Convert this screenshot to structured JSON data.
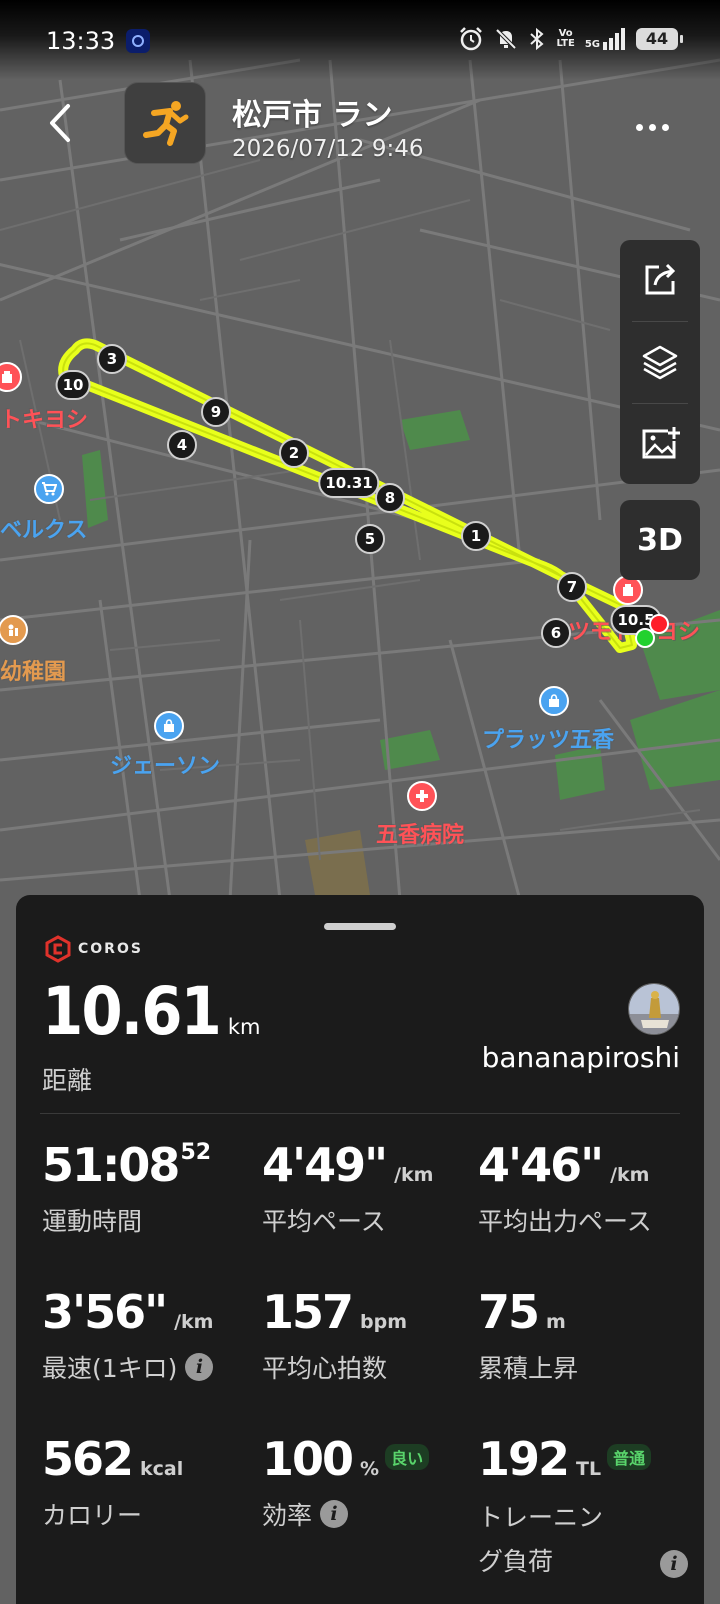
{
  "status_bar": {
    "time": "13:33",
    "volte": "Vo\nLTE",
    "network": "5G",
    "battery": "44"
  },
  "header": {
    "title": "松戸市 ラン",
    "datetime": "2026/07/12 9:46"
  },
  "map": {
    "poi": [
      {
        "id": "tokiyoshi",
        "label": "トキヨシ"
      },
      {
        "id": "belx",
        "label": "ベルクス"
      },
      {
        "id": "kindergarten",
        "label": "幼稚園"
      },
      {
        "id": "jayson",
        "label": "ジェーソン"
      },
      {
        "id": "plats",
        "label": "プラッツ五香"
      },
      {
        "id": "hospital",
        "label": "五香病院"
      },
      {
        "id": "matsumoto",
        "label": "マツモトキヨシ"
      }
    ],
    "km_markers": [
      "3",
      "10",
      "9",
      "4",
      "2",
      "10.31",
      "8",
      "5",
      "1",
      "7",
      "10.5",
      "6"
    ],
    "route_color": "#e8ff1c",
    "toggle_3d": "3D"
  },
  "summary": {
    "brand": "COROS",
    "distance_value": "10.61",
    "distance_unit": "km",
    "distance_label": "距離",
    "username": "bananapiroshi",
    "stats": [
      {
        "value": "51:08",
        "sup": "52",
        "unit": "",
        "label": "運動時間"
      },
      {
        "value": "4'49\"",
        "unit": "/km",
        "label": "平均ペース"
      },
      {
        "value": "4'46\"",
        "unit": "/km",
        "label": "平均出力ペース"
      },
      {
        "value": "3'56\"",
        "unit": "/km",
        "label": "最速(1キロ)"
      },
      {
        "value": "157",
        "unit": "bpm",
        "label": "平均心拍数"
      },
      {
        "value": "75",
        "unit": "m",
        "label": "累積上昇"
      },
      {
        "value": "562",
        "unit": "kcal",
        "label": "カロリー"
      },
      {
        "value": "100",
        "unit": "%",
        "badge": "良い",
        "label": "効率"
      },
      {
        "value": "192",
        "unit": "TL",
        "badge": "普通",
        "label": "トレーニン\nグ負荷"
      }
    ],
    "badge_color": "#59d46b"
  }
}
